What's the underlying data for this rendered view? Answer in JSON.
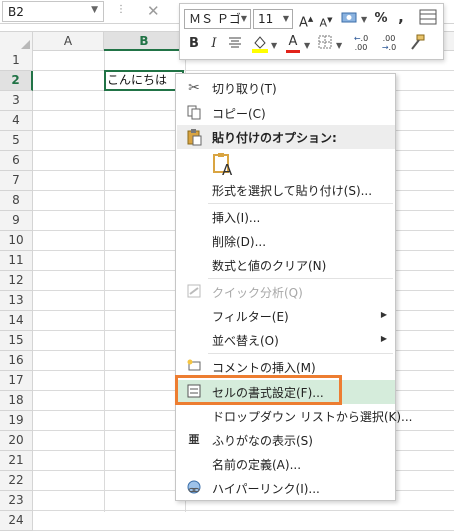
{
  "formula_bar": {
    "name_box": "B2",
    "cancel_glyph": "✕"
  },
  "grid": {
    "columns": [
      "A",
      "B"
    ],
    "rows": [
      "1",
      "2",
      "3",
      "4",
      "5",
      "6",
      "7",
      "8",
      "9",
      "10",
      "11",
      "12",
      "13",
      "14",
      "15",
      "16",
      "17",
      "18",
      "19",
      "20",
      "21",
      "22",
      "23",
      "24"
    ],
    "selected_cell_value": "こんにちは"
  },
  "mini_toolbar": {
    "font_name": "ＭＳ Ｐゴ",
    "font_size": "11",
    "grow_font": "A",
    "shrink_font": "A",
    "percent": "%",
    "comma": ",",
    "bold": "B",
    "italic": "I",
    "font_color_glyph": "A",
    "increase_decimal": ".0",
    "decrease_decimal": ".00",
    "accent_yellow": "#ffff00",
    "accent_red": "#e2231a"
  },
  "context_menu": {
    "items": [
      {
        "label": "切り取り(T)",
        "icon": "scissors-icon"
      },
      {
        "label": "コピー(C)",
        "icon": "copy-icon"
      },
      {
        "label": "貼り付けのオプション:",
        "icon": "paste-icon"
      },
      {
        "label": "A",
        "icon": "paste-keep-text-icon"
      },
      {
        "label": "形式を選択して貼り付け(S)..."
      },
      {
        "label": "挿入(I)..."
      },
      {
        "label": "削除(D)..."
      },
      {
        "label": "数式と値のクリア(N)"
      },
      {
        "label": "クイック分析(Q)",
        "icon": "quick-analysis-icon",
        "disabled": true
      },
      {
        "label": "フィルター(E)",
        "submenu": true
      },
      {
        "label": "並べ替え(O)",
        "submenu": true
      },
      {
        "label": "コメントの挿入(M)",
        "icon": "comment-icon"
      },
      {
        "label": "セルの書式設定(F)...",
        "icon": "format-cells-icon",
        "highlighted": true
      },
      {
        "label": "ドロップダウン リストから選択(K)..."
      },
      {
        "label": "ふりがなの表示(S)",
        "icon": "furigana-icon"
      },
      {
        "label": "名前の定義(A)..."
      },
      {
        "label": "ハイパーリンク(I)...",
        "icon": "hyperlink-icon"
      }
    ]
  },
  "colors": {
    "excel_green": "#217346",
    "highlight_bg": "#d5ecdb",
    "callout_orange": "#ed7d31"
  }
}
